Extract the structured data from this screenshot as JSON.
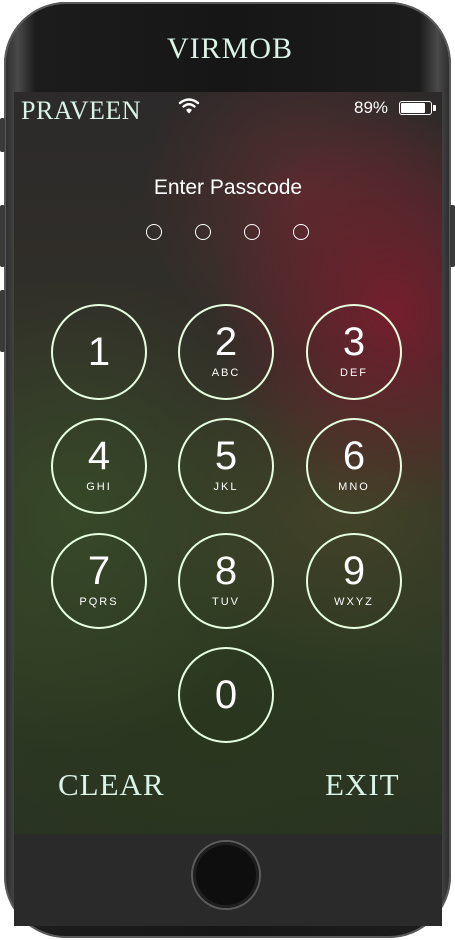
{
  "header": {
    "title": "VIRMOB"
  },
  "status_bar": {
    "carrier": "PRAVEEN",
    "battery_percent": "89%",
    "battery_level": 0.89,
    "wifi_icon": "wifi-icon"
  },
  "lock": {
    "prompt": "Enter Passcode",
    "entered_digits": 0,
    "max_digits": 4
  },
  "keypad": [
    {
      "digit": "1",
      "letters": ""
    },
    {
      "digit": "2",
      "letters": "ABC"
    },
    {
      "digit": "3",
      "letters": "DEF"
    },
    {
      "digit": "4",
      "letters": "GHI"
    },
    {
      "digit": "5",
      "letters": "JKL"
    },
    {
      "digit": "6",
      "letters": "MNO"
    },
    {
      "digit": "7",
      "letters": "PQRS"
    },
    {
      "digit": "8",
      "letters": "TUV"
    },
    {
      "digit": "9",
      "letters": "WXYZ"
    },
    {
      "digit": "0",
      "letters": ""
    }
  ],
  "actions": {
    "clear_label": "CLEAR",
    "exit_label": "EXIT"
  }
}
